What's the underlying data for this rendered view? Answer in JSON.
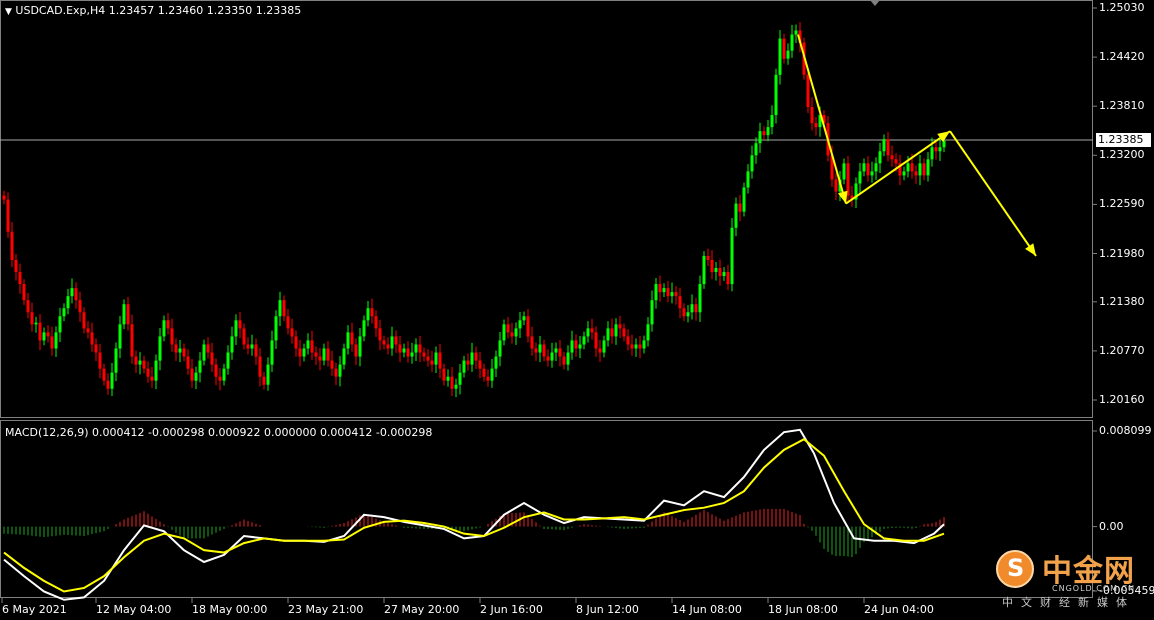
{
  "header": {
    "text": "USDCAD.Exp,H4  1.23457 1.23460 1.23350 1.23385",
    "menu_icon": "triangle-down-icon"
  },
  "macd_header": "MACD(12,26,9) 0.000412 -0.000298 0.000922 0.000000 0.000412 -0.000298",
  "price_axis": [
    "1.25030",
    "1.24420",
    "1.23810",
    "1.23200",
    "1.22590",
    "1.21980",
    "1.21380",
    "1.20770",
    "1.20160"
  ],
  "current_price": "1.23385",
  "macd_axis": [
    "0.008099",
    "0.00",
    "-0.005459"
  ],
  "time_axis": [
    "6 May 2021",
    "12 May 04:00",
    "18 May 00:00",
    "23 May 21:00",
    "27 May 20:00",
    "2 Jun 16:00",
    "8 Jun 12:00",
    "14 Jun 08:00",
    "18 Jun 08:00",
    "24 Jun 04:00"
  ],
  "watermark": {
    "name": "中金网",
    "url": "CNGOLD.COM.CN",
    "subtitle": "中文财经新媒体",
    "logo_char": "S"
  },
  "colors": {
    "bull": "#00ff00",
    "bear": "#ff0000",
    "annotation": "#ffff00",
    "macd_line": "#ffffff",
    "signal_line": "#ffff00",
    "hist_positive": "#8b0000",
    "hist_negative": "#006400"
  },
  "chart_data": {
    "type": "candlestick",
    "symbol": "USDCAD.Exp",
    "timeframe": "H4",
    "ohlc_current": {
      "open": 1.23457,
      "high": 1.2346,
      "low": 1.2335,
      "close": 1.23385
    },
    "ylim": [
      1.1985,
      1.2515
    ],
    "close_path": [
      [
        0,
        1.2265
      ],
      [
        4,
        1.2225
      ],
      [
        8,
        1.219
      ],
      [
        12,
        1.2175
      ],
      [
        16,
        1.216
      ],
      [
        20,
        1.214
      ],
      [
        24,
        1.2125
      ],
      [
        28,
        1.211
      ],
      [
        32,
        1.2112
      ],
      [
        36,
        1.209
      ],
      [
        40,
        1.21
      ],
      [
        44,
        1.2095
      ],
      [
        48,
        1.208
      ],
      [
        52,
        1.21
      ],
      [
        56,
        1.212
      ],
      [
        60,
        1.213
      ],
      [
        64,
        1.2145
      ],
      [
        68,
        1.2155
      ],
      [
        72,
        1.214
      ],
      [
        76,
        1.2125
      ],
      [
        80,
        1.2105
      ],
      [
        84,
        1.21
      ],
      [
        88,
        1.2085
      ],
      [
        92,
        1.2075
      ],
      [
        96,
        1.2055
      ],
      [
        100,
        1.204
      ],
      [
        104,
        1.203
      ],
      [
        108,
        1.205
      ],
      [
        112,
        1.208
      ],
      [
        116,
        1.211
      ],
      [
        120,
        1.2135
      ],
      [
        124,
        1.211
      ],
      [
        128,
        1.207
      ],
      [
        132,
        1.206
      ],
      [
        136,
        1.2065
      ],
      [
        140,
        1.2055
      ],
      [
        144,
        1.2045
      ],
      [
        148,
        1.204
      ],
      [
        152,
        1.2065
      ],
      [
        156,
        1.2095
      ],
      [
        160,
        1.2115
      ],
      [
        164,
        1.2105
      ],
      [
        168,
        1.2085
      ],
      [
        172,
        1.2075
      ],
      [
        176,
        1.208
      ],
      [
        180,
        1.207
      ],
      [
        184,
        1.2055
      ],
      [
        188,
        1.204
      ],
      [
        192,
        1.205
      ],
      [
        196,
        1.2065
      ],
      [
        200,
        1.2085
      ],
      [
        204,
        1.2075
      ],
      [
        208,
        1.206
      ],
      [
        212,
        1.2045
      ],
      [
        216,
        1.204
      ],
      [
        220,
        1.2055
      ],
      [
        224,
        1.2075
      ],
      [
        228,
        1.2095
      ],
      [
        232,
        1.2115
      ],
      [
        236,
        1.2105
      ],
      [
        240,
        1.2085
      ],
      [
        244,
        1.208
      ],
      [
        248,
        1.2085
      ],
      [
        252,
        1.207
      ],
      [
        256,
        1.2045
      ],
      [
        260,
        1.2035
      ],
      [
        264,
        1.206
      ],
      [
        268,
        1.209
      ],
      [
        272,
        1.212
      ],
      [
        276,
        1.214
      ],
      [
        280,
        1.212
      ],
      [
        284,
        1.2105
      ],
      [
        288,
        1.2095
      ],
      [
        292,
        1.208
      ],
      [
        296,
        1.207
      ],
      [
        300,
        1.208
      ],
      [
        304,
        1.209
      ],
      [
        308,
        1.2075
      ],
      [
        312,
        1.207
      ],
      [
        316,
        1.2065
      ],
      [
        320,
        1.208
      ],
      [
        324,
        1.2065
      ],
      [
        328,
        1.2055
      ],
      [
        332,
        1.2045
      ],
      [
        336,
        1.206
      ],
      [
        340,
        1.208
      ],
      [
        344,
        1.21
      ],
      [
        348,
        1.2085
      ],
      [
        352,
        1.207
      ],
      [
        356,
        1.2095
      ],
      [
        360,
        1.2115
      ],
      [
        364,
        1.213
      ],
      [
        368,
        1.212
      ],
      [
        372,
        1.2105
      ],
      [
        376,
        1.209
      ],
      [
        380,
        1.2085
      ],
      [
        384,
        1.208
      ],
      [
        388,
        1.2095
      ],
      [
        392,
        1.2085
      ],
      [
        396,
        1.2075
      ],
      [
        400,
        1.208
      ],
      [
        404,
        1.207
      ],
      [
        408,
        1.2075
      ],
      [
        412,
        1.2085
      ],
      [
        416,
        1.2075
      ],
      [
        420,
        1.207
      ],
      [
        424,
        1.2065
      ],
      [
        428,
        1.206
      ],
      [
        432,
        1.2075
      ],
      [
        436,
        1.2055
      ],
      [
        440,
        1.204
      ],
      [
        444,
        1.2045
      ],
      [
        448,
        1.203
      ],
      [
        452,
        1.2035
      ],
      [
        456,
        1.205
      ],
      [
        460,
        1.2065
      ],
      [
        464,
        1.206
      ],
      [
        468,
        1.2075
      ],
      [
        472,
        1.2065
      ],
      [
        476,
        1.2055
      ],
      [
        480,
        1.2045
      ],
      [
        484,
        1.204
      ],
      [
        488,
        1.2055
      ],
      [
        492,
        1.207
      ],
      [
        496,
        1.209
      ],
      [
        500,
        1.211
      ],
      [
        504,
        1.21
      ],
      [
        508,
        1.2095
      ],
      [
        512,
        1.2105
      ],
      [
        516,
        1.2115
      ],
      [
        520,
        1.212
      ],
      [
        524,
        1.2095
      ],
      [
        528,
        1.208
      ],
      [
        532,
        1.2075
      ],
      [
        536,
        1.2085
      ],
      [
        540,
        1.207
      ],
      [
        544,
        1.2065
      ],
      [
        548,
        1.2075
      ],
      [
        552,
        1.208
      ],
      [
        556,
        1.207
      ],
      [
        560,
        1.206
      ],
      [
        564,
        1.2075
      ],
      [
        568,
        1.209
      ],
      [
        572,
        1.208
      ],
      [
        576,
        1.2085
      ],
      [
        580,
        1.2095
      ],
      [
        584,
        1.2105
      ],
      [
        588,
        1.21
      ],
      [
        592,
        1.208
      ],
      [
        596,
        1.2075
      ],
      [
        600,
        1.209
      ],
      [
        604,
        1.2105
      ],
      [
        608,
        1.2095
      ],
      [
        612,
        1.211
      ],
      [
        616,
        1.2105
      ],
      [
        620,
        1.2095
      ],
      [
        624,
        1.2085
      ],
      [
        628,
        1.208
      ],
      [
        632,
        1.2085
      ],
      [
        636,
        1.208
      ],
      [
        640,
        1.209
      ],
      [
        644,
        1.211
      ],
      [
        648,
        1.214
      ],
      [
        652,
        1.216
      ],
      [
        656,
        1.215
      ],
      [
        660,
        1.2155
      ],
      [
        664,
        1.2145
      ],
      [
        668,
        1.215
      ],
      [
        672,
        1.2145
      ],
      [
        676,
        1.213
      ],
      [
        680,
        1.212
      ],
      [
        684,
        1.2125
      ],
      [
        688,
        1.2135
      ],
      [
        692,
        1.2125
      ],
      [
        696,
        1.216
      ],
      [
        700,
        1.2195
      ],
      [
        704,
        1.219
      ],
      [
        708,
        1.2175
      ],
      [
        712,
        1.218
      ],
      [
        716,
        1.217
      ],
      [
        720,
        1.2175
      ],
      [
        724,
        1.216
      ],
      [
        728,
        1.223
      ],
      [
        732,
        1.226
      ],
      [
        736,
        1.225
      ],
      [
        740,
        1.228
      ],
      [
        744,
        1.23
      ],
      [
        748,
        1.232
      ],
      [
        752,
        1.2335
      ],
      [
        756,
        1.235
      ],
      [
        760,
        1.2345
      ],
      [
        764,
        1.2355
      ],
      [
        768,
        1.237
      ],
      [
        772,
        1.242
      ],
      [
        776,
        1.2465
      ],
      [
        780,
        1.244
      ],
      [
        784,
        1.245
      ],
      [
        788,
        1.247
      ],
      [
        792,
        1.2475
      ],
      [
        796,
        1.246
      ],
      [
        800,
        1.242
      ],
      [
        804,
        1.238
      ],
      [
        808,
        1.236
      ],
      [
        812,
        1.2355
      ],
      [
        816,
        1.237
      ],
      [
        820,
        1.236
      ],
      [
        824,
        1.232
      ],
      [
        828,
        1.229
      ],
      [
        832,
        1.2275
      ],
      [
        836,
        1.229
      ],
      [
        840,
        1.231
      ],
      [
        844,
        1.227
      ],
      [
        848,
        1.2265
      ],
      [
        852,
        1.2285
      ],
      [
        856,
        1.23
      ],
      [
        860,
        1.231
      ],
      [
        864,
        1.2295
      ],
      [
        868,
        1.23
      ],
      [
        872,
        1.231
      ],
      [
        876,
        1.2325
      ],
      [
        880,
        1.234
      ],
      [
        884,
        1.232
      ],
      [
        888,
        1.2315
      ],
      [
        892,
        1.231
      ],
      [
        896,
        1.2295
      ],
      [
        900,
        1.23
      ],
      [
        904,
        1.231
      ],
      [
        908,
        1.23
      ],
      [
        912,
        1.2295
      ],
      [
        916,
        1.231
      ],
      [
        920,
        1.2295
      ],
      [
        924,
        1.2315
      ],
      [
        928,
        1.233
      ],
      [
        932,
        1.2325
      ],
      [
        936,
        1.233
      ],
      [
        940,
        1.2338
      ]
    ],
    "annotation_arrows": [
      {
        "from": [
          798,
          1.247
        ],
        "to": [
          846,
          1.226
        ]
      },
      {
        "from": [
          846,
          1.226
        ],
        "to": [
          950,
          1.235
        ]
      },
      {
        "from": [
          950,
          1.235
        ],
        "to": [
          1036,
          1.2195
        ]
      }
    ],
    "macd": {
      "ylim": [
        -0.0068,
        0.0082
      ],
      "macd_line": [
        [
          0,
          -0.0028
        ],
        [
          20,
          -0.0042
        ],
        [
          40,
          -0.0055
        ],
        [
          60,
          -0.0062
        ],
        [
          80,
          -0.006
        ],
        [
          100,
          -0.0046
        ],
        [
          120,
          -0.002
        ],
        [
          140,
          0.0001
        ],
        [
          160,
          -0.0004
        ],
        [
          180,
          -0.002
        ],
        [
          200,
          -0.003
        ],
        [
          220,
          -0.0024
        ],
        [
          240,
          -0.0008
        ],
        [
          260,
          -0.001
        ],
        [
          280,
          -0.0012
        ],
        [
          300,
          -0.0012
        ],
        [
          320,
          -0.0013
        ],
        [
          340,
          -0.0008
        ],
        [
          360,
          0.001
        ],
        [
          380,
          0.0008
        ],
        [
          400,
          0.0004
        ],
        [
          420,
          0.0001
        ],
        [
          440,
          -0.0002
        ],
        [
          460,
          -0.001
        ],
        [
          480,
          -0.0008
        ],
        [
          500,
          0.001
        ],
        [
          520,
          0.002
        ],
        [
          540,
          0.001
        ],
        [
          560,
          0.0003
        ],
        [
          580,
          0.0008
        ],
        [
          600,
          0.0007
        ],
        [
          620,
          0.0006
        ],
        [
          640,
          0.0005
        ],
        [
          660,
          0.0022
        ],
        [
          680,
          0.0018
        ],
        [
          700,
          0.003
        ],
        [
          720,
          0.0025
        ],
        [
          740,
          0.0042
        ],
        [
          760,
          0.0065
        ],
        [
          780,
          0.008
        ],
        [
          796,
          0.0082
        ],
        [
          810,
          0.0062
        ],
        [
          830,
          0.002
        ],
        [
          850,
          -0.001
        ],
        [
          870,
          -0.0012
        ],
        [
          890,
          -0.0012
        ],
        [
          910,
          -0.0014
        ],
        [
          930,
          -0.0006
        ],
        [
          940,
          0.0002
        ]
      ],
      "signal_line": [
        [
          0,
          -0.0022
        ],
        [
          20,
          -0.0035
        ],
        [
          40,
          -0.0046
        ],
        [
          60,
          -0.0055
        ],
        [
          80,
          -0.0052
        ],
        [
          100,
          -0.0042
        ],
        [
          120,
          -0.0026
        ],
        [
          140,
          -0.0012
        ],
        [
          160,
          -0.0006
        ],
        [
          180,
          -0.001
        ],
        [
          200,
          -0.002
        ],
        [
          220,
          -0.0022
        ],
        [
          240,
          -0.0014
        ],
        [
          260,
          -0.001
        ],
        [
          280,
          -0.0012
        ],
        [
          300,
          -0.0012
        ],
        [
          320,
          -0.0012
        ],
        [
          340,
          -0.0011
        ],
        [
          360,
          -0.0001
        ],
        [
          380,
          0.0004
        ],
        [
          400,
          0.0005
        ],
        [
          420,
          0.0003
        ],
        [
          440,
          0.0
        ],
        [
          460,
          -0.0006
        ],
        [
          480,
          -0.0008
        ],
        [
          500,
          -0.0001
        ],
        [
          520,
          0.0008
        ],
        [
          540,
          0.0012
        ],
        [
          560,
          0.0006
        ],
        [
          580,
          0.0006
        ],
        [
          600,
          0.0007
        ],
        [
          620,
          0.0008
        ],
        [
          640,
          0.0006
        ],
        [
          660,
          0.001
        ],
        [
          680,
          0.0014
        ],
        [
          700,
          0.0016
        ],
        [
          720,
          0.002
        ],
        [
          740,
          0.003
        ],
        [
          760,
          0.005
        ],
        [
          780,
          0.0065
        ],
        [
          800,
          0.0074
        ],
        [
          820,
          0.006
        ],
        [
          840,
          0.003
        ],
        [
          860,
          0.0002
        ],
        [
          880,
          -0.001
        ],
        [
          900,
          -0.0012
        ],
        [
          920,
          -0.0012
        ],
        [
          940,
          -0.0006
        ]
      ]
    },
    "xlabel": "",
    "ylabel": ""
  }
}
